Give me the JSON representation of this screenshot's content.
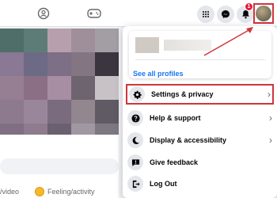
{
  "topbar": {
    "notification_count": "1",
    "icons": [
      "groups-icon",
      "gaming-icon",
      "menu-grid-icon",
      "messenger-icon",
      "bell-icon",
      "account-avatar"
    ]
  },
  "feed": {
    "actions_left": "/video",
    "actions_right": "Feeling/activity"
  },
  "dropdown": {
    "see_all_profiles": "See all profiles",
    "items": [
      {
        "label": "Settings & privacy",
        "icon": "gear-icon",
        "chevron": true
      },
      {
        "label": "Help & support",
        "icon": "question-icon",
        "chevron": true
      },
      {
        "label": "Display & accessibility",
        "icon": "moon-icon",
        "chevron": true
      },
      {
        "label": "Give feedback",
        "icon": "feedback-icon",
        "chevron": false
      },
      {
        "label": "Log Out",
        "icon": "logout-icon",
        "chevron": false
      }
    ]
  },
  "colors": {
    "annotation_red": "#d0343c",
    "link_blue": "#1877f2",
    "icon_bg": "#e4e6eb"
  }
}
